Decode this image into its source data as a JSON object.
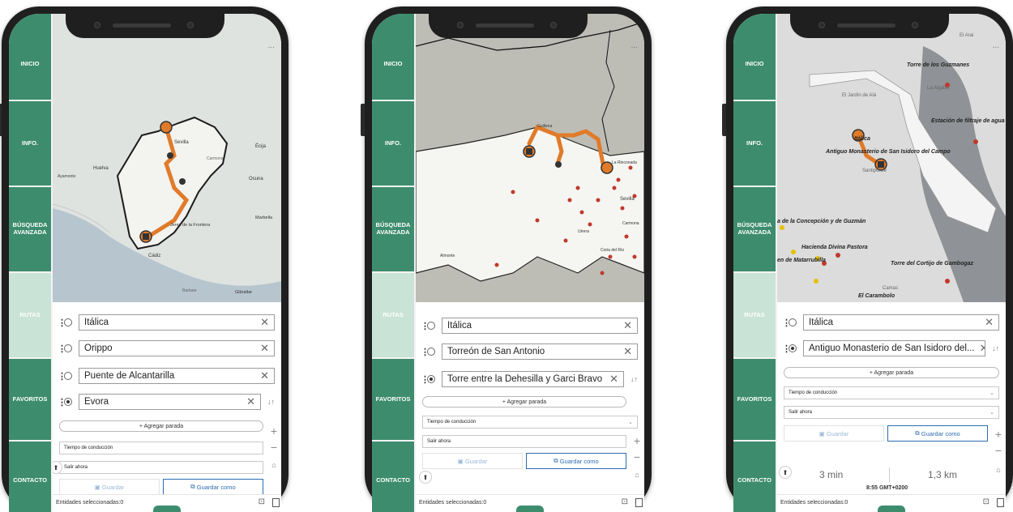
{
  "nav": [
    "INICIO",
    "INFO.",
    "BÚSQUEDA AVANZADA",
    "RUTAS",
    "FAVORITOS",
    "CONTACTO"
  ],
  "common": {
    "add_stop": "+ Agregar parada",
    "travel_mode": "Tiempo de conducción",
    "depart": "Salir ahora",
    "save": "Guardar",
    "save_as": "Guardar como",
    "selected": "Entidades seleccionadas:0",
    "more": "..."
  },
  "phone1": {
    "stops": [
      "Itálica",
      "Orippo",
      "Puente de Alcantarilla",
      "Evora"
    ],
    "map_labels": [
      "Sevilla",
      "Huelva",
      "Jerez de la Frontera",
      "Cádiz",
      "Écija",
      "Osuna",
      "Marbella",
      "Gibraltar",
      "Carmona",
      "Ayamonte",
      "Barbate"
    ]
  },
  "phone2": {
    "stops": [
      "Itálica",
      "Torreón de San Antonio",
      "Torre entre la Dehesilla y Garci Bravo"
    ],
    "map_labels": [
      "Sevilla",
      "La Rinconada",
      "Guillena",
      "Utrera",
      "Almonte",
      "Carmona",
      "Coria del Río"
    ]
  },
  "phone3": {
    "stops": [
      "Itálica",
      "Antiguo Monasterio de San Isidoro del..."
    ],
    "map_labels": {
      "guzmanes": "Torre de los Guzmanes",
      "filtraje": "Estación de filtraje de agua",
      "italica": "Itálica",
      "monasterio": "Antiguo Monasterio de San Isidoro del Campo",
      "concepcion": "a de la Concepción y de Guzmán",
      "pastora": "Hacienda Divina Pastora",
      "matarrubilla": "en de Matarrubilla",
      "gambogaz": "Torre del Cortijo de Gambogaz",
      "carambolo": "El Carambolo",
      "jardin": "El Jardín de Alá",
      "camas": "Camas",
      "santiponce": "Santiponce",
      "algaba": "La Algaba",
      "arai": "El Arai"
    },
    "result": {
      "time": "3 min",
      "distance": "1,3 km",
      "arrival": "8:55 GMT+0200"
    }
  },
  "colors": {
    "nav": "#3d8c6e",
    "nav_active": "#c9e3d6",
    "route": "#e07b2a",
    "accent": "#2b6cb0"
  }
}
